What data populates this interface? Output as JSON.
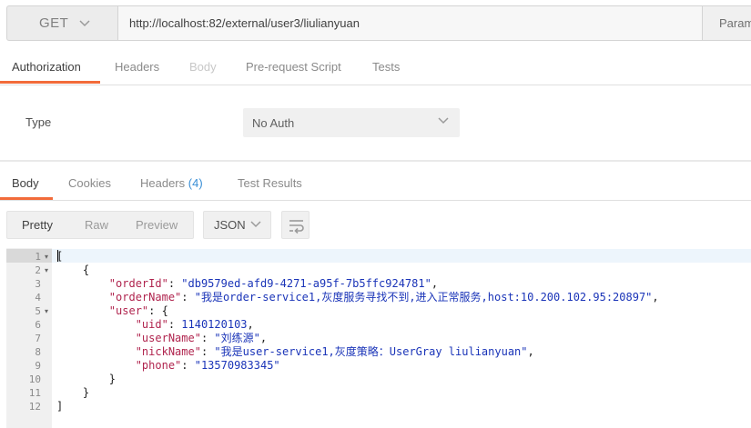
{
  "request": {
    "method": "GET",
    "url": "http://localhost:82/external/user3/liulianyuan",
    "params_label": "Params"
  },
  "request_tabs": [
    {
      "label": "Authorization",
      "state": "active"
    },
    {
      "label": "Headers",
      "state": "normal"
    },
    {
      "label": "Body",
      "state": "disabled"
    },
    {
      "label": "Pre-request Script",
      "state": "normal"
    },
    {
      "label": "Tests",
      "state": "normal"
    }
  ],
  "auth": {
    "type_label": "Type",
    "selected": "No Auth"
  },
  "response_tabs": [
    {
      "label": "Body",
      "state": "active"
    },
    {
      "label": "Cookies",
      "state": "normal"
    },
    {
      "label": "Headers",
      "count": "(4)",
      "state": "normal"
    },
    {
      "label": "Test Results",
      "state": "normal"
    }
  ],
  "view": {
    "modes": [
      "Pretty",
      "Raw",
      "Preview"
    ],
    "active_mode": "Pretty",
    "format": "JSON",
    "wrap_icon": "wrap-lines-icon"
  },
  "colors": {
    "accent": "#f26b3a",
    "json_key": "#b0244e",
    "json_string": "#1a34b8",
    "count": "#3a8fd6"
  },
  "code": {
    "line_numbers": [
      "1",
      "2",
      "3",
      "4",
      "5",
      "6",
      "7",
      "8",
      "9",
      "10",
      "11",
      "12"
    ],
    "lines": [
      {
        "indent": "",
        "parts": [
          [
            "p",
            "["
          ]
        ]
      },
      {
        "indent": "    ",
        "parts": [
          [
            "p",
            "{"
          ]
        ]
      },
      {
        "indent": "        ",
        "parts": [
          [
            "k",
            "\"orderId\""
          ],
          [
            "p",
            ": "
          ],
          [
            "s",
            "\"db9579ed-afd9-4271-a95f-7b5ffc924781\""
          ],
          [
            "p",
            ","
          ]
        ]
      },
      {
        "indent": "        ",
        "parts": [
          [
            "k",
            "\"orderName\""
          ],
          [
            "p",
            ": "
          ],
          [
            "s",
            "\"我是order-service1,灰度服务寻找不到,进入正常服务,host:10.200.102.95:20897\""
          ],
          [
            "p",
            ","
          ]
        ]
      },
      {
        "indent": "        ",
        "parts": [
          [
            "k",
            "\"user\""
          ],
          [
            "p",
            ": {"
          ]
        ]
      },
      {
        "indent": "            ",
        "parts": [
          [
            "k",
            "\"uid\""
          ],
          [
            "p",
            ": "
          ],
          [
            "n",
            "1140120103"
          ],
          [
            "p",
            ","
          ]
        ]
      },
      {
        "indent": "            ",
        "parts": [
          [
            "k",
            "\"userName\""
          ],
          [
            "p",
            ": "
          ],
          [
            "s",
            "\"刘练源\""
          ],
          [
            "p",
            ","
          ]
        ]
      },
      {
        "indent": "            ",
        "parts": [
          [
            "k",
            "\"nickName\""
          ],
          [
            "p",
            ": "
          ],
          [
            "s",
            "\"我是user-service1,灰度策略：UserGray liulianyuan\""
          ],
          [
            "p",
            ","
          ]
        ]
      },
      {
        "indent": "            ",
        "parts": [
          [
            "k",
            "\"phone\""
          ],
          [
            "p",
            ": "
          ],
          [
            "s",
            "\"13570983345\""
          ]
        ]
      },
      {
        "indent": "        ",
        "parts": [
          [
            "p",
            "}"
          ]
        ]
      },
      {
        "indent": "    ",
        "parts": [
          [
            "p",
            "}"
          ]
        ]
      },
      {
        "indent": "",
        "parts": [
          [
            "p",
            "]"
          ]
        ]
      }
    ],
    "foldable_lines": [
      1,
      2,
      5
    ]
  }
}
